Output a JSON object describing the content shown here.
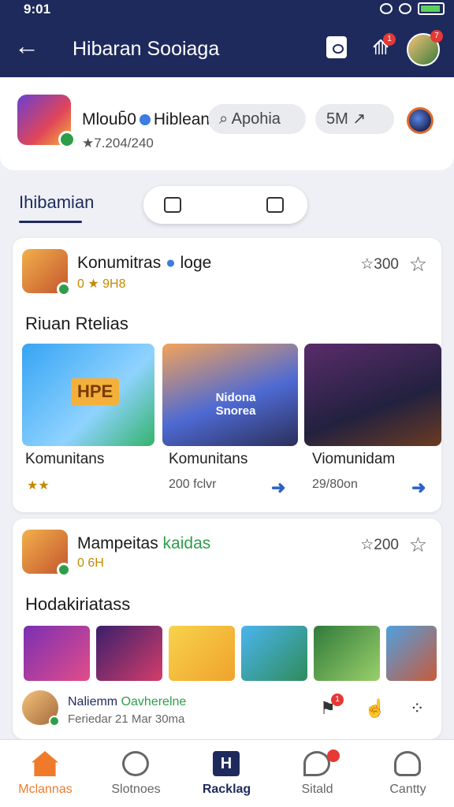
{
  "status": {
    "time": "9:01"
  },
  "appbar": {
    "title": "Hibaran Sooiaga",
    "notif_count": "1",
    "avatar_badge": "7"
  },
  "profile": {
    "name": "Mloub̄0",
    "tag": "Hiblean",
    "stats": "★7.204/240",
    "search_pill": "Apohia",
    "size_pill": "5M"
  },
  "tabs": {
    "active": "Ihibamian"
  },
  "card1": {
    "title": "Konumitras",
    "title_extra": "loge",
    "subtitle": "0 ★ 9H8",
    "rating": "☆300",
    "section": "Riuan Rtelias",
    "thumb1_text": "HPE",
    "thumb2_text": "Nidona Snorea",
    "items": [
      {
        "label": "Komunitans",
        "meta": "★★"
      },
      {
        "label": "Komunitans",
        "meta": "200 fclvr"
      },
      {
        "label": "Viomunidam",
        "meta": "29/80on"
      }
    ]
  },
  "card2": {
    "title": "Mampeitas",
    "title_extra": "kaidas",
    "subtitle": "0 6H",
    "rating": "☆200",
    "section": "Hodakiriatass",
    "user": {
      "name": "Naliemm",
      "handle": "Oavherelne",
      "date": "Feriedar 21 Mar 30ma"
    },
    "notif_count": "1"
  },
  "nav": [
    {
      "label": "Mclannas",
      "icon": "home-icon"
    },
    {
      "label": "Slotnoes",
      "icon": "clock-icon"
    },
    {
      "label": "Racklag",
      "icon": "h-icon"
    },
    {
      "label": "Sitald",
      "icon": "chat-icon"
    },
    {
      "label": "Cantty",
      "icon": "user-icon"
    }
  ],
  "colors": {
    "primary": "#1e2a5c",
    "accent": "#ef7b2a",
    "link": "#2a62c9",
    "online": "#2e9d4a"
  }
}
